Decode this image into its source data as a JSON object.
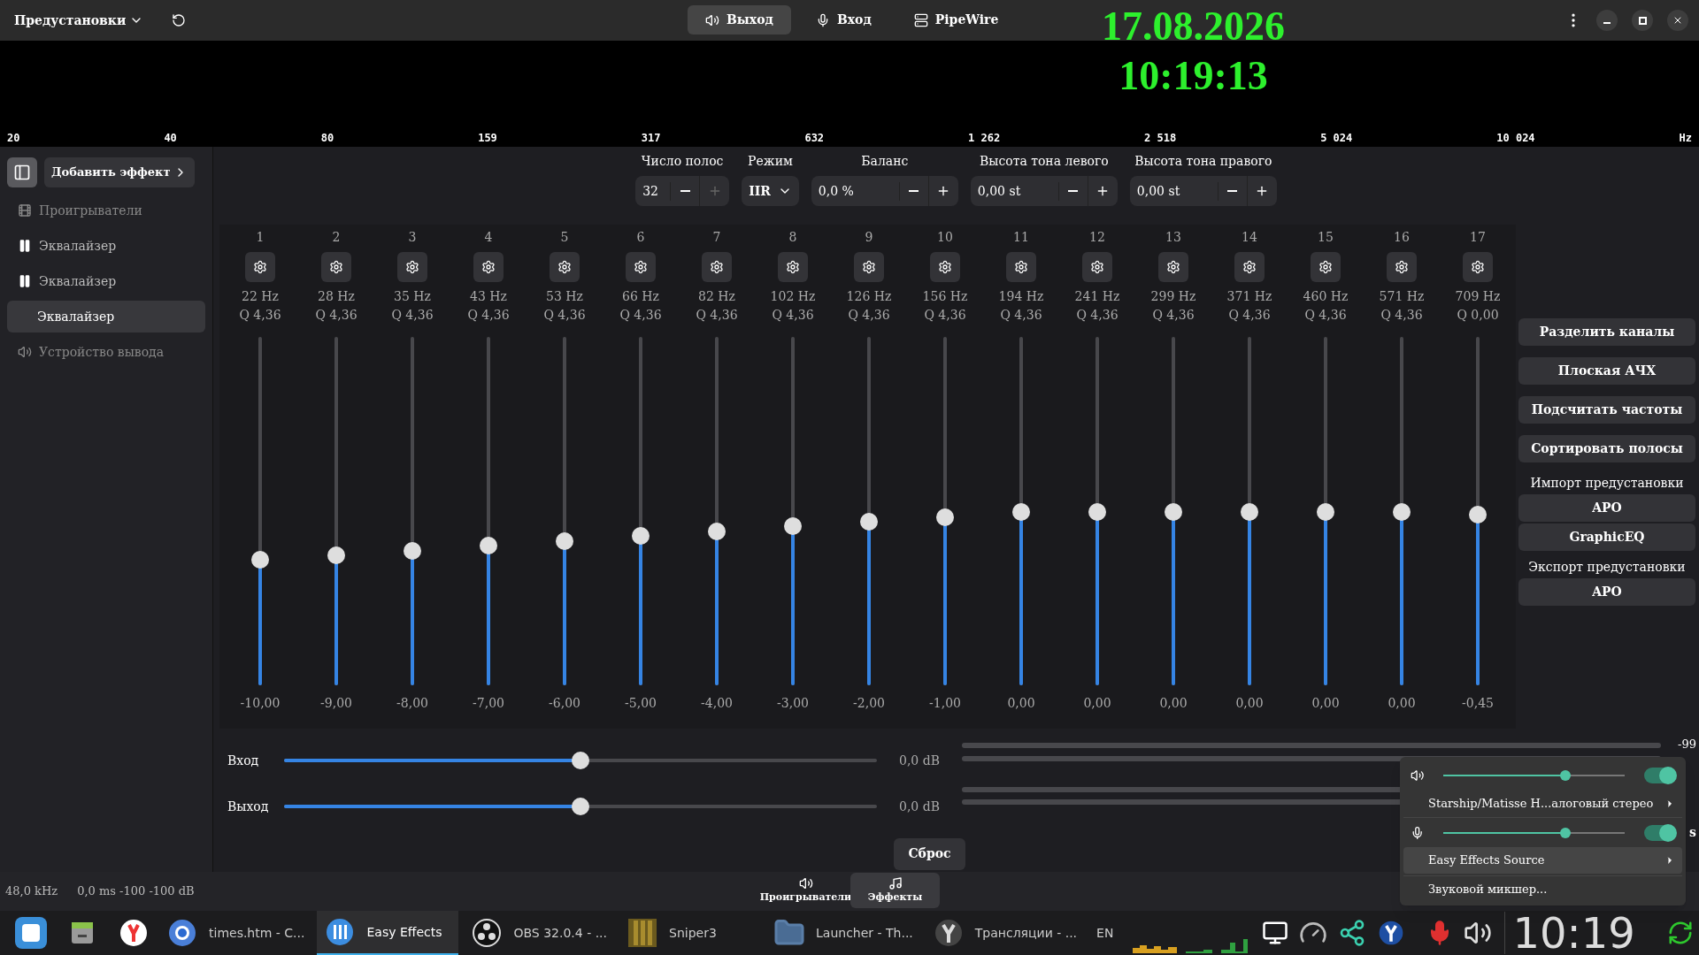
{
  "header": {
    "presets": "Предустановки",
    "tabs": [
      {
        "label": "Выход",
        "selected": true
      },
      {
        "label": "Вход",
        "selected": false
      },
      {
        "label": "PipeWire",
        "selected": false
      }
    ]
  },
  "clock_widget": {
    "date": "17.08.2026",
    "time": "10:19:13"
  },
  "spectrum": {
    "labels": [
      "20",
      "40",
      "80",
      "159",
      "317",
      "632",
      "1 262",
      "2 518",
      "5 024",
      "10 024",
      "Hz"
    ]
  },
  "sidebar": {
    "add_button": "Добавить эффект",
    "items": [
      {
        "label": "Проигрыватели",
        "kind": "players",
        "selected": false
      },
      {
        "label": "Эквалайзер",
        "kind": "effect",
        "selected": false
      },
      {
        "label": "Эквалайзер",
        "kind": "effect",
        "selected": false
      },
      {
        "label": "Эквалайзер",
        "kind": "effect",
        "selected": true
      },
      {
        "label": "Устройство вывода",
        "kind": "output",
        "selected": false
      }
    ]
  },
  "controls": {
    "bands": {
      "label": "Число полос",
      "value": "32"
    },
    "mode": {
      "label": "Режим",
      "value": "IIR"
    },
    "balance": {
      "label": "Баланс",
      "value": "0,0 %"
    },
    "pitch_left": {
      "label": "Высота тона левого",
      "value": "0,00 st"
    },
    "pitch_right": {
      "label": "Высота тона правого",
      "value": "0,00 st"
    }
  },
  "bands": [
    {
      "number": "1",
      "freq": "22 Hz",
      "q": "Q 4,36",
      "gain": "-10,00",
      "level": 0.36
    },
    {
      "number": "2",
      "freq": "28 Hz",
      "q": "Q 4,36",
      "gain": "-9,00",
      "level": 0.374
    },
    {
      "number": "3",
      "freq": "35 Hz",
      "q": "Q 4,36",
      "gain": "-8,00",
      "level": 0.387
    },
    {
      "number": "4",
      "freq": "43 Hz",
      "q": "Q 4,36",
      "gain": "-7,00",
      "level": 0.401
    },
    {
      "number": "5",
      "freq": "53 Hz",
      "q": "Q 4,36",
      "gain": "-6,00",
      "level": 0.415
    },
    {
      "number": "6",
      "freq": "66 Hz",
      "q": "Q 4,36",
      "gain": "-5,00",
      "level": 0.429
    },
    {
      "number": "7",
      "freq": "82 Hz",
      "q": "Q 4,36",
      "gain": "-4,00",
      "level": 0.442
    },
    {
      "number": "8",
      "freq": "102 Hz",
      "q": "Q 4,36",
      "gain": "-3,00",
      "level": 0.456
    },
    {
      "number": "9",
      "freq": "126 Hz",
      "q": "Q 4,36",
      "gain": "-2,00",
      "level": 0.47
    },
    {
      "number": "10",
      "freq": "156 Hz",
      "q": "Q 4,36",
      "gain": "-1,00",
      "level": 0.483
    },
    {
      "number": "11",
      "freq": "194 Hz",
      "q": "Q 4,36",
      "gain": "0,00",
      "level": 0.497
    },
    {
      "number": "12",
      "freq": "241 Hz",
      "q": "Q 4,36",
      "gain": "0,00",
      "level": 0.497
    },
    {
      "number": "13",
      "freq": "299 Hz",
      "q": "Q 4,36",
      "gain": "0,00",
      "level": 0.497
    },
    {
      "number": "14",
      "freq": "371 Hz",
      "q": "Q 4,36",
      "gain": "0,00",
      "level": 0.497
    },
    {
      "number": "15",
      "freq": "460 Hz",
      "q": "Q 4,36",
      "gain": "0,00",
      "level": 0.497
    },
    {
      "number": "16",
      "freq": "571 Hz",
      "q": "Q 4,36",
      "gain": "0,00",
      "level": 0.497
    },
    {
      "number": "17",
      "freq": "709 Hz",
      "q": "Q 0,00",
      "gain": "-0,45",
      "level": 0.491
    }
  ],
  "side_actions": [
    {
      "kind": "button",
      "label": "Разделить каналы"
    },
    {
      "kind": "button",
      "label": "Плоская АЧХ"
    },
    {
      "kind": "button",
      "label": "Подсчитать частоты"
    },
    {
      "kind": "button",
      "label": "Сортировать полосы"
    },
    {
      "kind": "heading",
      "label": "Импорт предустановки"
    },
    {
      "kind": "button",
      "label": "APO"
    },
    {
      "kind": "button",
      "label": "GraphicEQ"
    },
    {
      "kind": "heading",
      "label": "Экспорт предустановки"
    },
    {
      "kind": "button",
      "label": "APO"
    }
  ],
  "gains": [
    {
      "label": "Вход",
      "value": "0,0 dB",
      "level": 0.5
    },
    {
      "label": "Выход",
      "value": "0,0 dB",
      "level": 0.5
    }
  ],
  "meter_label": "-99",
  "meter_cut_label": "s",
  "reset_button": "Сброс",
  "status": {
    "rate": "48,0 kHz",
    "latency": "0,0 ms -100 -100 dB"
  },
  "bottom_tabs": [
    {
      "label": "Проигрыватели",
      "selected": false
    },
    {
      "label": "Эффекты",
      "selected": true
    }
  ],
  "popup": {
    "rows": [
      {
        "kind": "output-slider",
        "level": 0.67,
        "on": true
      },
      {
        "kind": "menu",
        "label": "Starship/Matisse H...алоговый стерео",
        "selected": false
      },
      {
        "kind": "input-slider",
        "level": 0.67,
        "on": true
      },
      {
        "kind": "menu",
        "label": "Easy Effects Source",
        "selected": true
      },
      {
        "kind": "plain",
        "label": "Звуковой микшер..."
      }
    ]
  },
  "taskbar": {
    "windows": [
      {
        "label": "times.htm - C...",
        "active": false
      },
      {
        "label": "Easy Effects",
        "active": true
      },
      {
        "label": "OBS 32.0.4 - ...",
        "active": false
      },
      {
        "label": "Sniper3",
        "active": false
      },
      {
        "label": "Launcher - Th...",
        "active": false
      },
      {
        "label": "Трансляции - ...",
        "active": false
      }
    ],
    "layout": "EN",
    "clock": "10:19"
  }
}
